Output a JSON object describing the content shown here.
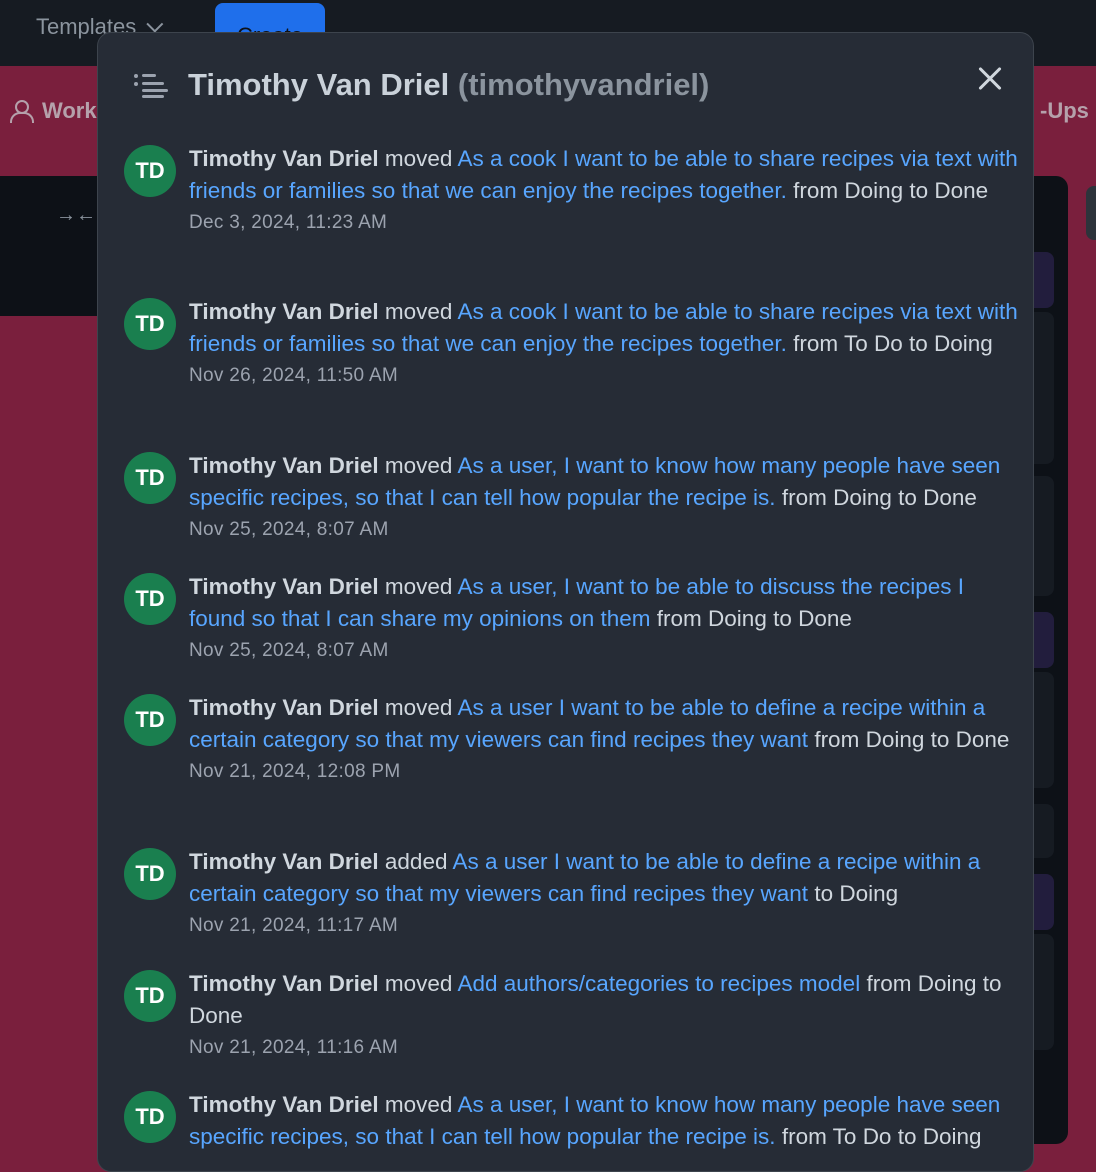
{
  "background": {
    "topbar": {
      "templates_label": "Templates",
      "create_label": "Create"
    },
    "boardbar": {
      "workspace_label": "Work",
      "right_label": "-Ups"
    }
  },
  "modal": {
    "title_name": "Timothy Van Driel",
    "title_handle": "(timothyvandriel)",
    "entries": [
      {
        "avatar": "TD",
        "actor": "Timothy Van Driel",
        "action": "moved",
        "item": "As a cook I want to be able to share recipes via text with friends or families so that we can enjoy the recipes together.",
        "detail": "from Doing to Done",
        "timestamp": "Dec 3, 2024, 11:23 AM"
      },
      {
        "avatar": "TD",
        "actor": "Timothy Van Driel",
        "action": "moved",
        "item": "As a cook I want to be able to share recipes via text with friends or families so that we can enjoy the recipes together.",
        "detail": "from To Do to Doing",
        "timestamp": "Nov 26, 2024, 11:50 AM"
      },
      {
        "avatar": "TD",
        "actor": "Timothy Van Driel",
        "action": "moved",
        "item": "As a user, I want to know how many people have seen specific recipes, so that I can tell how popular the recipe is.",
        "detail": "from Doing to Done",
        "timestamp": "Nov 25, 2024, 8:07 AM"
      },
      {
        "avatar": "TD",
        "actor": "Timothy Van Driel",
        "action": "moved",
        "item": "As a user, I want to be able to discuss the recipes I found so that I can share my opinions on them",
        "detail": "from Doing to Done",
        "timestamp": "Nov 25, 2024, 8:07 AM"
      },
      {
        "avatar": "TD",
        "actor": "Timothy Van Driel",
        "action": "moved",
        "item": "As a user I want to be able to define a recipe within a certain category so that my viewers can find recipes they want",
        "detail": "from Doing to Done",
        "timestamp": "Nov 21, 2024, 12:08 PM"
      },
      {
        "avatar": "TD",
        "actor": "Timothy Van Driel",
        "action": "added",
        "item": "As a user I want to be able to define a recipe within a certain category so that my viewers can find recipes they want",
        "detail": "to Doing",
        "timestamp": "Nov 21, 2024, 11:17 AM"
      },
      {
        "avatar": "TD",
        "actor": "Timothy Van Driel",
        "action": "moved",
        "item": "Add authors/categories to recipes model",
        "detail": "from Doing to Done",
        "timestamp": "Nov 21, 2024, 11:16 AM"
      },
      {
        "avatar": "TD",
        "actor": "Timothy Van Driel",
        "action": "moved",
        "item": "As a user, I want to know how many people have seen specific recipes, so that I can tell how popular the recipe is.",
        "detail": "from To Do to Doing",
        "timestamp": ""
      }
    ]
  },
  "colors": {
    "board_background": "#7a1f3d",
    "modal_background": "#262c36",
    "link": "#58a6ff",
    "avatar": "#1a7f4f"
  },
  "icons": {
    "header": "list-icon",
    "close": "close-icon",
    "collapse": "collapse-icon",
    "workspace": "people-icon"
  }
}
